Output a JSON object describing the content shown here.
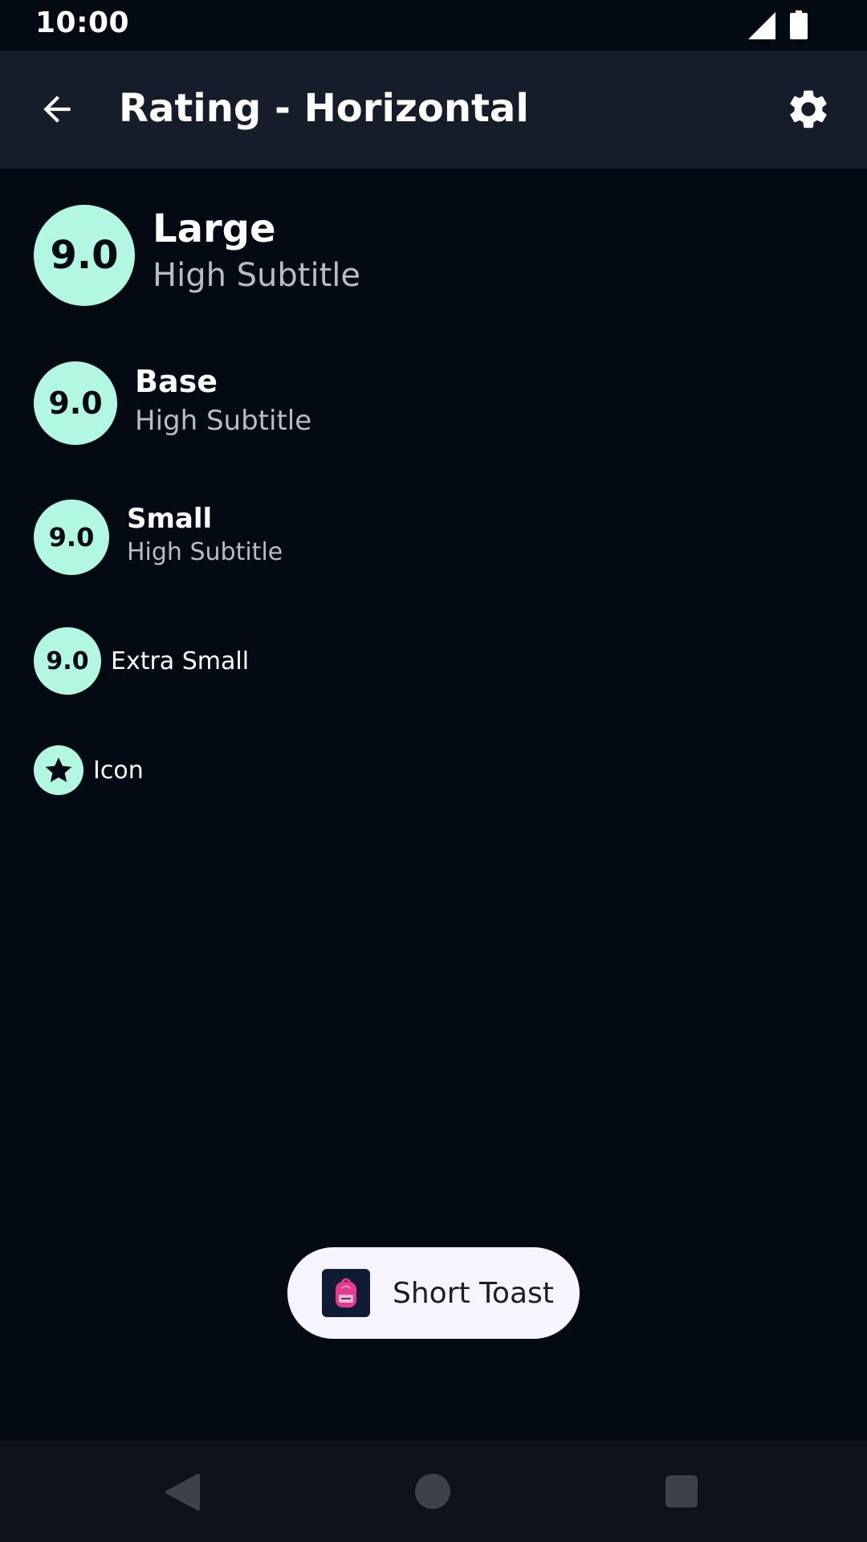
{
  "status_bar": {
    "time": "10:00",
    "icons": [
      "signal-icon",
      "battery-icon"
    ]
  },
  "app_bar": {
    "title": "Rating - Horizontal",
    "left_icon": "back-arrow-icon",
    "right_icon": "settings-gear-icon"
  },
  "ratings": {
    "large": {
      "value": "9.0",
      "title": "Large",
      "subtitle": "High Subtitle"
    },
    "base": {
      "value": "9.0",
      "title": "Base",
      "subtitle": "High Subtitle"
    },
    "small": {
      "value": "9.0",
      "title": "Small",
      "subtitle": "High Subtitle"
    },
    "extra_small": {
      "value": "9.0",
      "title": "Extra Small"
    },
    "icon": {
      "icon": "star-icon",
      "title": "Icon"
    }
  },
  "toast": {
    "text": "Short Toast",
    "app_icon": "backpack-app-icon"
  },
  "nav_bar": {
    "icons": [
      "nav-back-icon",
      "nav-home-icon",
      "nav-recents-icon"
    ]
  },
  "colors": {
    "background": "#030a14",
    "app_bar": "#151d2b",
    "badge": "#b2f7e1",
    "subtitle": "#b7bcc6",
    "toast_background": "#f6f4fc",
    "nav_bar": "#0e121c"
  }
}
